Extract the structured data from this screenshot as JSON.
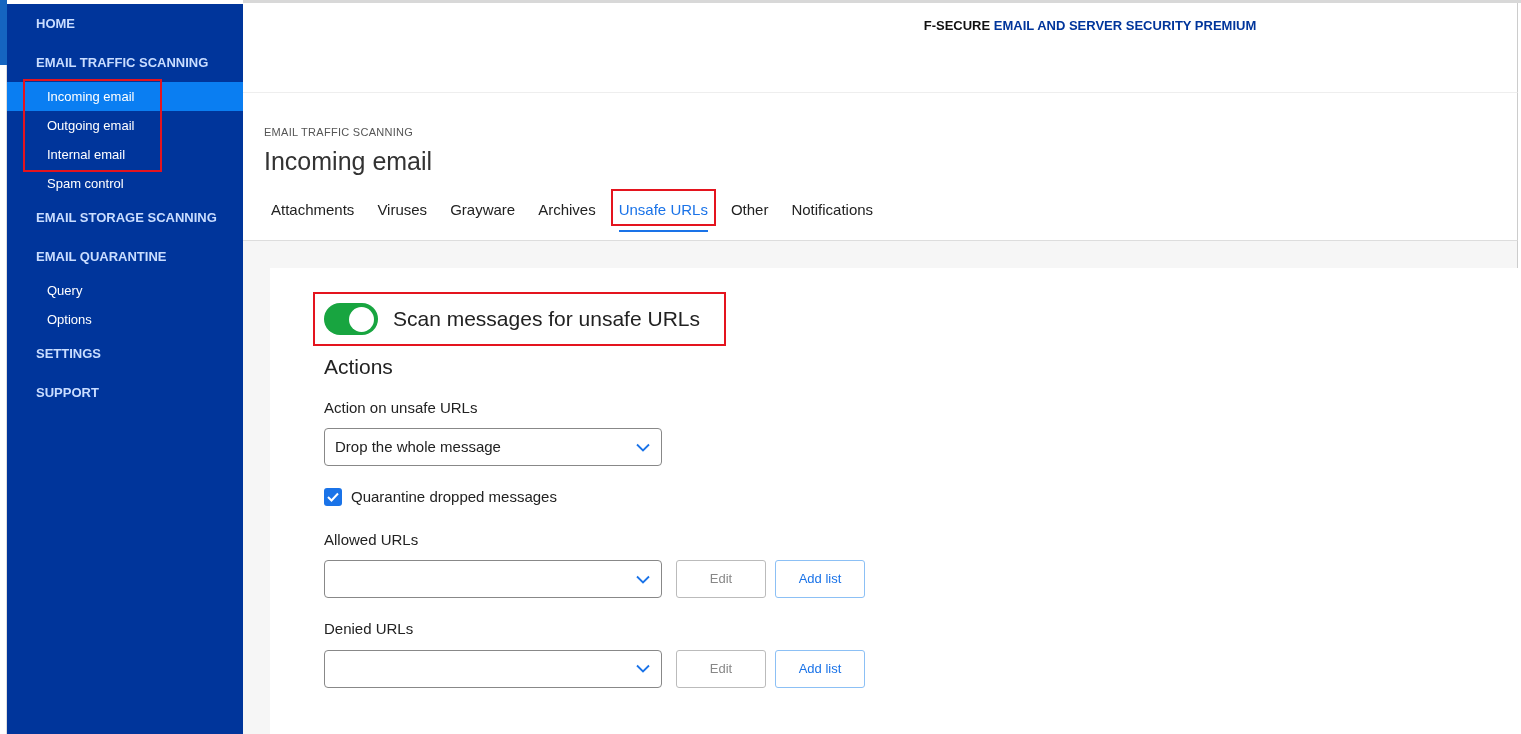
{
  "sidebar": {
    "sections": [
      {
        "label": "HOME"
      },
      {
        "label": "EMAIL TRAFFIC SCANNING",
        "items": [
          {
            "label": "Incoming email",
            "selected": true,
            "highlighted": true
          },
          {
            "label": "Outgoing email",
            "selected": false,
            "highlighted": true
          },
          {
            "label": "Internal email",
            "selected": false,
            "highlighted": true
          },
          {
            "label": "Spam control",
            "selected": false,
            "highlighted": false
          }
        ]
      },
      {
        "label": "EMAIL STORAGE SCANNING"
      },
      {
        "label": "EMAIL QUARANTINE",
        "items": [
          {
            "label": "Query",
            "selected": false,
            "highlighted": false
          },
          {
            "label": "Options",
            "selected": false,
            "highlighted": false
          }
        ]
      },
      {
        "label": "SETTINGS"
      },
      {
        "label": "SUPPORT"
      }
    ]
  },
  "header": {
    "brand": "F-SECURE",
    "product": "EMAIL AND SERVER SECURITY PREMIUM"
  },
  "page": {
    "breadcrumb": "EMAIL TRAFFIC SCANNING",
    "title": "Incoming email"
  },
  "tabs": [
    {
      "label": "Attachments",
      "selected": false,
      "highlighted": false
    },
    {
      "label": "Viruses",
      "selected": false,
      "highlighted": false
    },
    {
      "label": "Grayware",
      "selected": false,
      "highlighted": false
    },
    {
      "label": "Archives",
      "selected": false,
      "highlighted": false
    },
    {
      "label": "Unsafe URLs",
      "selected": true,
      "highlighted": true
    },
    {
      "label": "Other",
      "selected": false,
      "highlighted": false
    },
    {
      "label": "Notifications",
      "selected": false,
      "highlighted": false
    }
  ],
  "toggle": {
    "label": "Scan messages for unsafe URLs",
    "on": true,
    "highlighted": true
  },
  "actions": {
    "heading": "Actions",
    "action_label": "Action on unsafe URLs",
    "action_value": "Drop the whole message",
    "quarantine": {
      "label": "Quarantine dropped messages",
      "checked": true
    },
    "lists": [
      {
        "label": "Allowed URLs",
        "buttons": [
          {
            "label": "Edit",
            "disabled": true
          },
          {
            "label": "Add list",
            "disabled": false
          }
        ]
      },
      {
        "label": "Denied URLs",
        "buttons": [
          {
            "label": "Edit",
            "disabled": true
          },
          {
            "label": "Add list",
            "disabled": false
          }
        ]
      }
    ]
  }
}
